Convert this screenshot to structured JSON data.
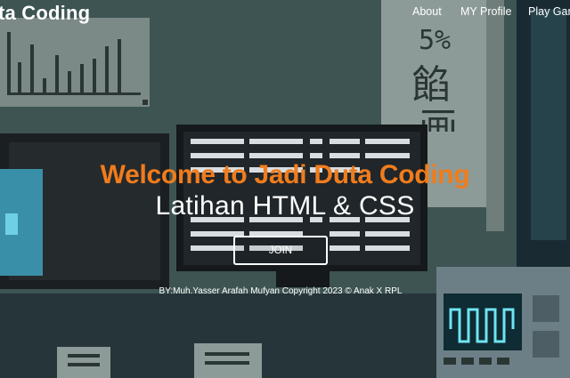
{
  "header": {
    "brand": "ta Coding",
    "nav": [
      {
        "label": "About"
      },
      {
        "label": "MY Profile"
      },
      {
        "label": "Play Gam"
      }
    ]
  },
  "hero": {
    "title": "Welcome to Jadi Duta Coding",
    "subtitle": "Latihan HTML & CSS",
    "join_label": "JOIN"
  },
  "footer": {
    "text": "BY:Muh.Yasser Arafah Mufyan Copyright 2023 © Anak X RPL"
  },
  "colors": {
    "accent": "#f07c1c",
    "text": "#ffffff",
    "background": "#3a4f4d"
  },
  "background_image": {
    "poster_right_glyphs": [
      "5%",
      "餡",
      "画"
    ]
  }
}
